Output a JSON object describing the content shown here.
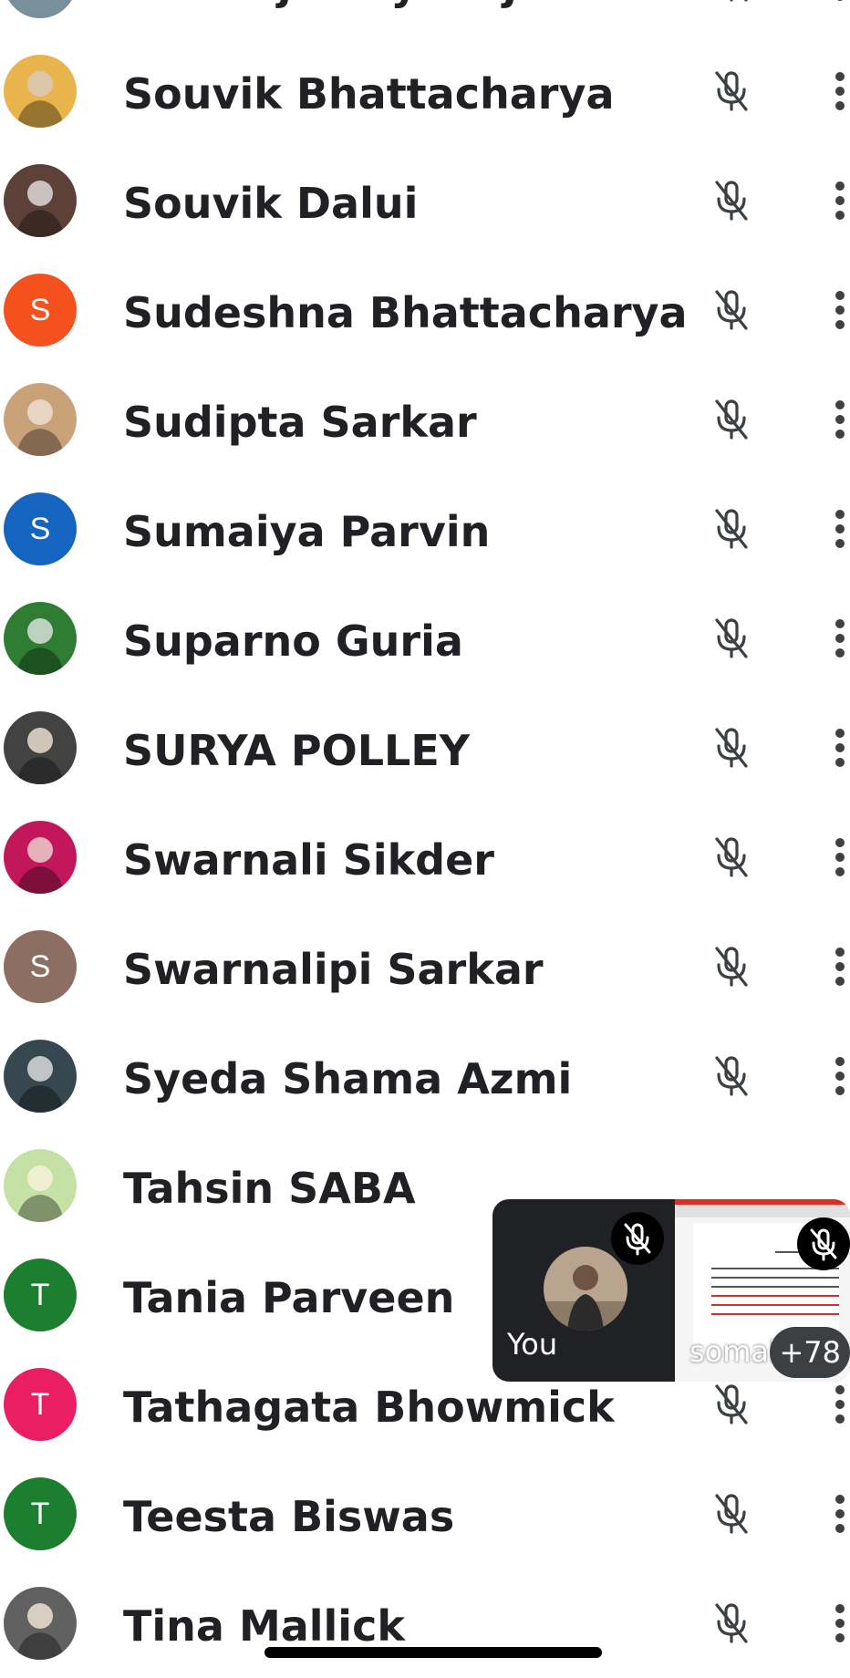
{
  "participants": [
    {
      "name": "Soubirjamay Majumder",
      "avatar_type": "letter",
      "initial": "S",
      "color": "#78909c"
    },
    {
      "name": "Souvik Bhattacharya",
      "avatar_type": "photo",
      "color": "#e9b44c"
    },
    {
      "name": "Souvik Dalui",
      "avatar_type": "photo",
      "color": "#5d4037"
    },
    {
      "name": "Sudeshna Bhattacharya",
      "avatar_type": "letter",
      "initial": "S",
      "color": "#f4511e"
    },
    {
      "name": "Sudipta Sarkar",
      "avatar_type": "photo",
      "color": "#c9a27a"
    },
    {
      "name": "Sumaiya Parvin",
      "avatar_type": "letter",
      "initial": "S",
      "color": "#1565c0"
    },
    {
      "name": "Suparno Guria",
      "avatar_type": "photo",
      "color": "#2e7d32"
    },
    {
      "name": "SURYA POLLEY",
      "avatar_type": "photo",
      "color": "#424242"
    },
    {
      "name": "Swarnali Sikder",
      "avatar_type": "photo",
      "color": "#c2185b"
    },
    {
      "name": "Swarnalipi Sarkar",
      "avatar_type": "letter",
      "initial": "S",
      "color": "#8d6e63"
    },
    {
      "name": "Syeda Shama Azmi",
      "avatar_type": "photo",
      "color": "#37474f"
    },
    {
      "name": "Tahsin SABA",
      "avatar_type": "photo",
      "color": "#c5e1a5"
    },
    {
      "name": "Tania Parveen",
      "avatar_type": "letter",
      "initial": "T",
      "color": "#1b7f2f"
    },
    {
      "name": "Tathagata Bhowmick",
      "avatar_type": "letter",
      "initial": "T",
      "color": "#e91e63"
    },
    {
      "name": "Teesta Biswas",
      "avatar_type": "letter",
      "initial": "T",
      "color": "#1b7f2f"
    },
    {
      "name": "Tina Mallick",
      "avatar_type": "photo",
      "color": "#616161"
    }
  ],
  "icons": {
    "mic": "mic-off-icon",
    "menu": "more-vert-icon"
  },
  "floating_view": {
    "self_label": "You",
    "shared_name": "somak",
    "more_count": "+78"
  },
  "colors": {
    "text": "#202124",
    "icon": "#3c4043",
    "tile_bg": "#202124",
    "share_border": "#d93025"
  }
}
